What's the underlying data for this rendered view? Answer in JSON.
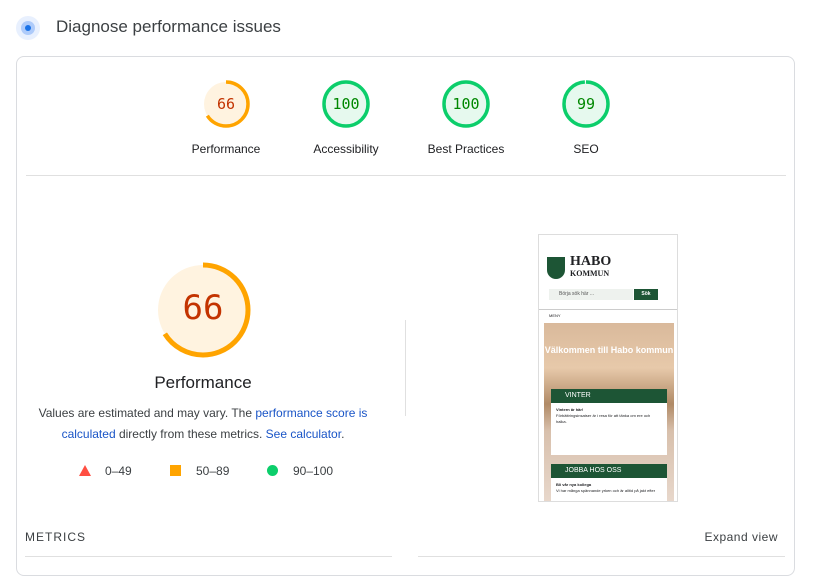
{
  "header": {
    "title": "Diagnose performance issues",
    "icon": "gauge-icon"
  },
  "colors": {
    "average": "#ffa400",
    "average_text": "#c33300",
    "average_bg": "#fff3e0",
    "pass": "#0cce6b",
    "pass_text": "#008800",
    "pass_bg": "#e6f9ee",
    "fail": "#ff4e42",
    "link": "#1a55c7"
  },
  "categories": [
    {
      "label": "Performance",
      "score": 66,
      "status": "average"
    },
    {
      "label": "Accessibility",
      "score": 100,
      "status": "pass"
    },
    {
      "label": "Best Practices",
      "score": 100,
      "status": "pass"
    },
    {
      "label": "SEO",
      "score": 99,
      "status": "pass"
    }
  ],
  "main": {
    "score": "66",
    "label": "Performance",
    "desc_pre": "Values are estimated and may vary. The ",
    "link1": "performance score is calculated",
    "desc_mid": " directly from these metrics. ",
    "link2": "See calculator",
    "desc_post": "."
  },
  "legend": [
    {
      "range": "0–49",
      "shape": "triangle"
    },
    {
      "range": "50–89",
      "shape": "square"
    },
    {
      "range": "90–100",
      "shape": "circle"
    }
  ],
  "thumbnail": {
    "brand1": "HABO",
    "brand2": "KOMMUN",
    "search_placeholder": "Börja sök här ...",
    "search_button": "Sök",
    "menu": "MENY",
    "hero": "Välkommen till Habo kommun",
    "card1_title": "VINTER",
    "card1_heading": "Vintern är här!",
    "card1_text": "Förbättringsinsatser är i resa för att tänka om ere och halka.",
    "card2_title": "JOBBA HOS OSS",
    "card2_heading": "Bli vår nya kollega",
    "card2_text": "Vi har många spännande yrken och är alltid på jakt efter"
  },
  "metrics": {
    "label": "METRICS",
    "expand": "Expand view"
  }
}
